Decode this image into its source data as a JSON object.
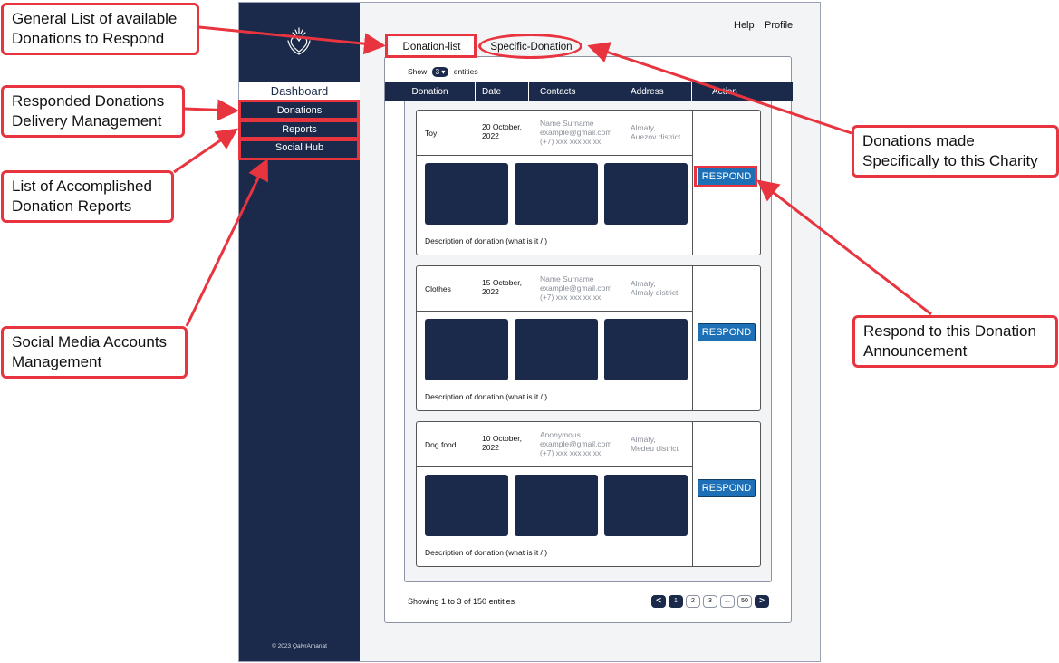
{
  "header": {
    "help": "Help",
    "profile": "Profile"
  },
  "sidebar": {
    "dashboard": "Dashboard",
    "items": [
      {
        "label": "Donations"
      },
      {
        "label": "Reports"
      },
      {
        "label": "Social Hub"
      }
    ],
    "copyright": "© 2023 QalyrAmanat"
  },
  "tabs": [
    {
      "label": "Donation-list"
    },
    {
      "label": "Specific-Donation"
    }
  ],
  "table": {
    "show_prefix": "Show",
    "entities_selected": "3",
    "show_suffix": "entities",
    "columns": [
      "Donation",
      "Date",
      "Contacts",
      "Address",
      "Action"
    ],
    "rows": [
      {
        "donation": "Toy",
        "date": [
          "20 October,",
          "2022"
        ],
        "contact": [
          "Name Surname",
          "example@gmail.com",
          "(+7) xxx xxx xx xx"
        ],
        "address": [
          "Almaty,",
          "Auezov district"
        ],
        "description": "Description of donation (what is it / )",
        "action": "RESPOND"
      },
      {
        "donation": "Clothes",
        "date": [
          "15 October,",
          "2022"
        ],
        "contact": [
          "Name Surname",
          "example@gmail.com",
          "(+7) xxx xxx xx xx"
        ],
        "address": [
          "Almaty,",
          "Almaly district"
        ],
        "description": "Description of donation (what is it / )",
        "action": "RESPOND"
      },
      {
        "donation": "Dog food",
        "date": [
          "10 October,",
          "2022"
        ],
        "contact": [
          "Anonymous",
          "example@gmail.com",
          "(+7) xxx xxx xx xx"
        ],
        "address": [
          "Almaty,",
          "Medeu district"
        ],
        "description": "Description of donation (what is it / )",
        "action": "RESPOND"
      }
    ],
    "footer": "Showing 1 to 3 of 150 entities",
    "pagination": {
      "prev": "<",
      "pages": [
        "1",
        "2",
        "3",
        "...",
        "50"
      ],
      "next": ">",
      "current": "1"
    }
  },
  "annotations": [
    {
      "text": [
        "General List of available",
        "Donations to Respond"
      ]
    },
    {
      "text": [
        "Responded Donations",
        "Delivery Management"
      ]
    },
    {
      "text": [
        "List of Accomplished",
        "Donation Reports"
      ]
    },
    {
      "text": [
        "Social Media Accounts",
        "Management"
      ]
    },
    {
      "text": [
        "Donations made",
        "Specifically to this Charity"
      ]
    },
    {
      "text": [
        "Respond to this Donation",
        "Announcement"
      ]
    }
  ],
  "colors": {
    "navy": "#1b2a4a",
    "accent_red": "#e8343f",
    "respond_blue": "#1d6fb6"
  }
}
